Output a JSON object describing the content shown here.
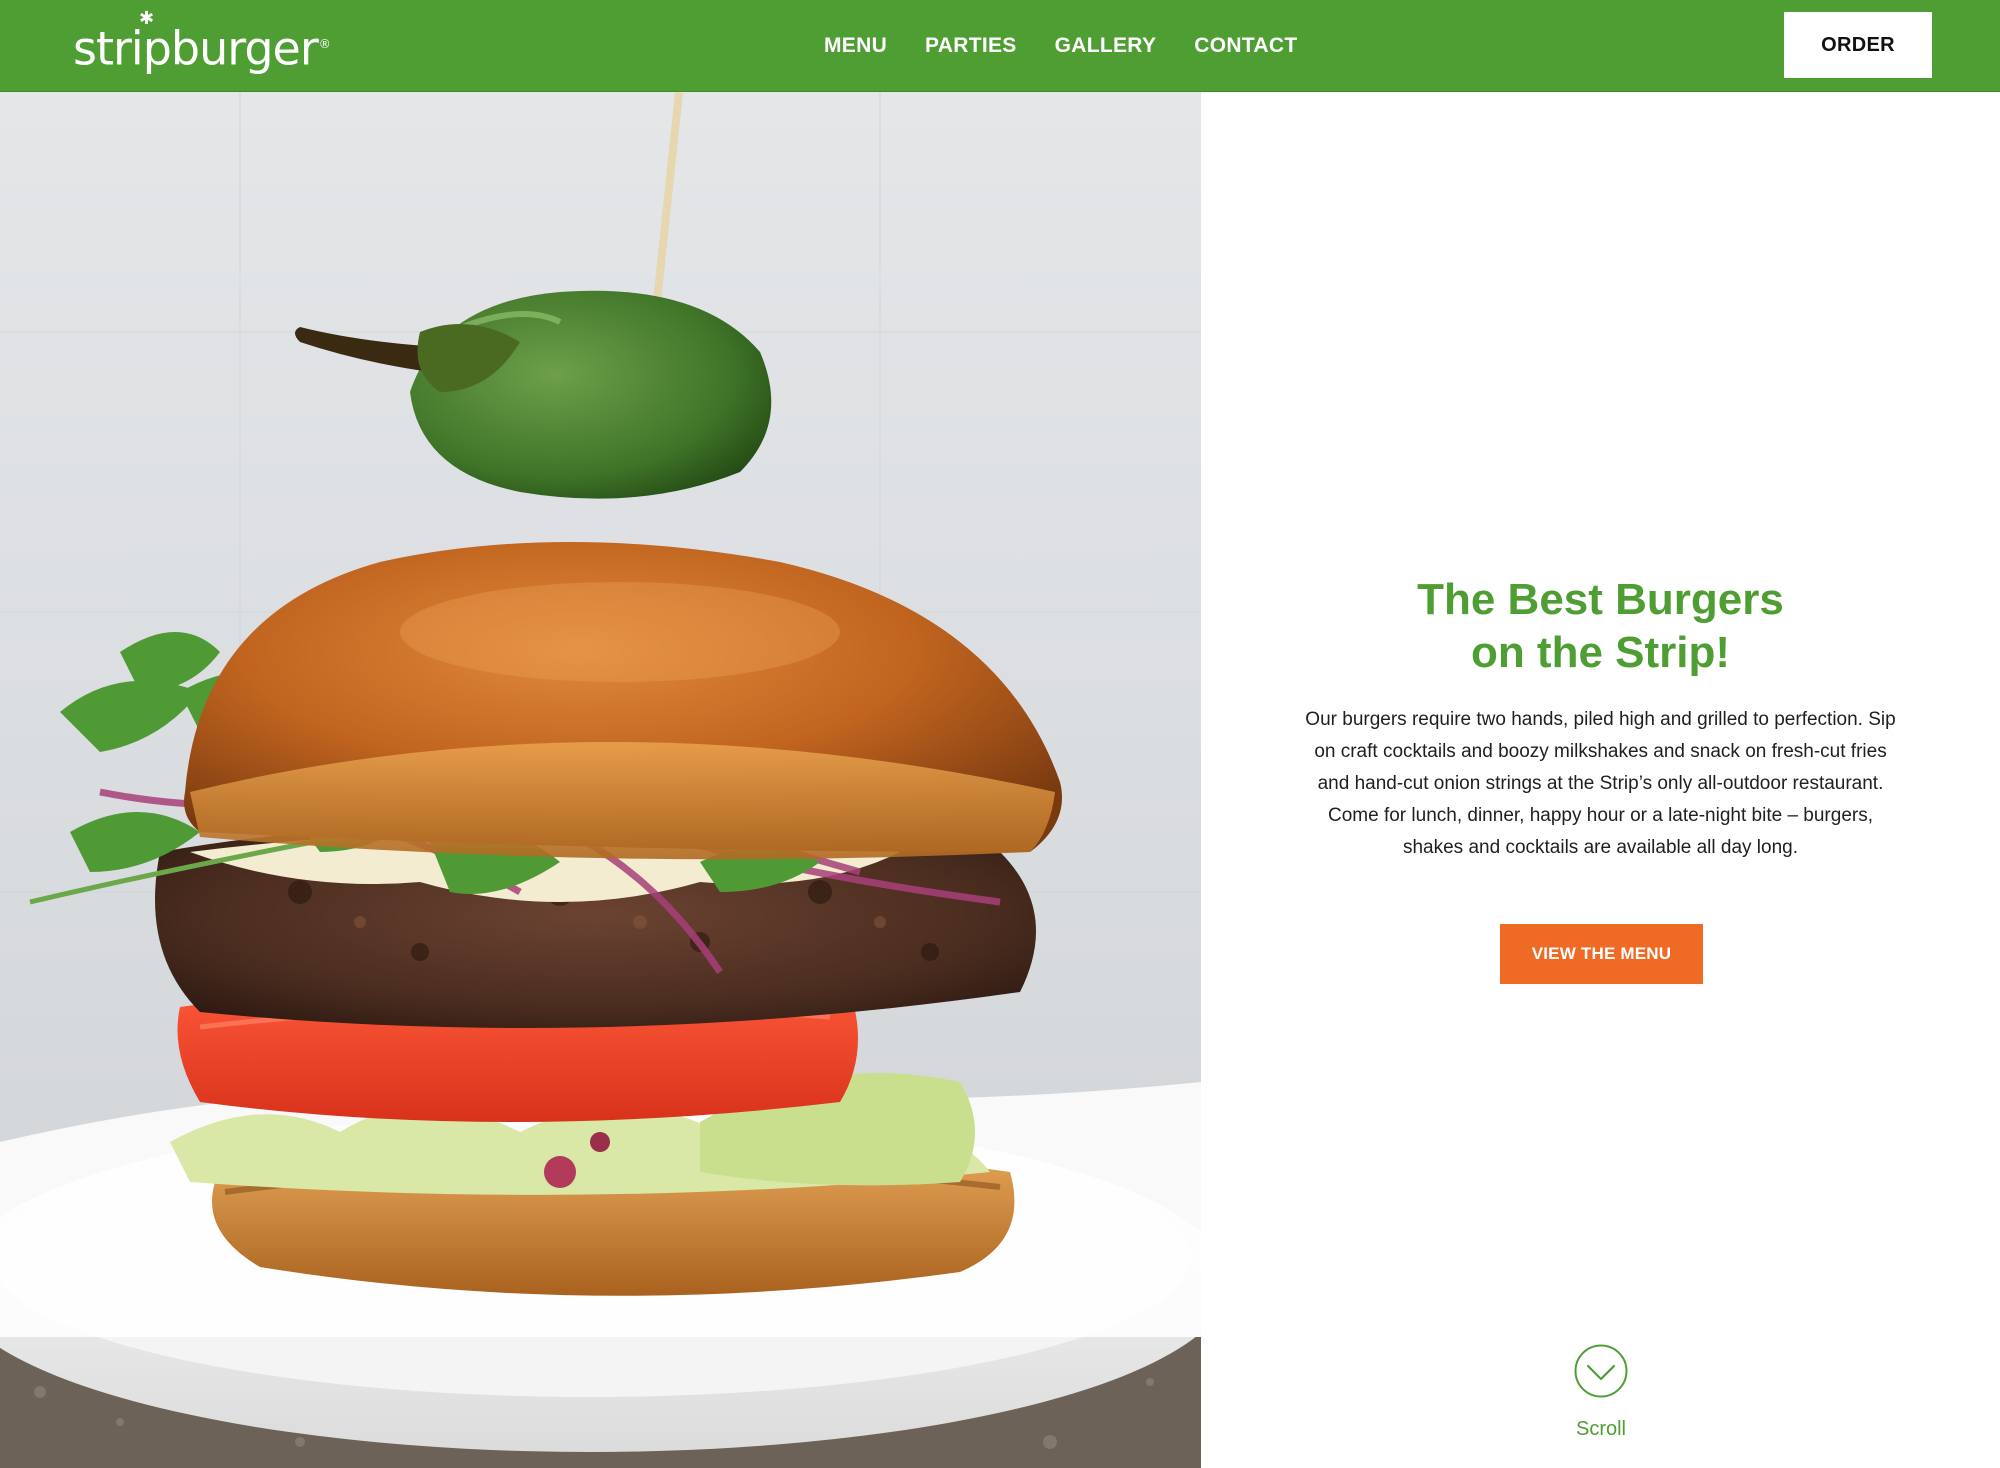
{
  "header": {
    "logo_text": "stripburger",
    "logo_reg": "®",
    "nav": [
      {
        "label": "MENU"
      },
      {
        "label": "PARTIES"
      },
      {
        "label": "GALLERY"
      },
      {
        "label": "CONTACT"
      }
    ],
    "order_label": "ORDER",
    "brand_color": "#4f9e33"
  },
  "hero": {
    "headline_line1": "The Best Burgers",
    "headline_line2": "on the Strip!",
    "description": "Our burgers require two hands, piled high and grilled to perfection. Sip on craft cocktails and boozy milkshakes and snack on fresh-cut fries and hand-cut onion strings at the Strip’s only all-outdoor restaurant. Come for lunch, dinner, happy hour or a late-night bite – burgers, shakes and cocktails are available all day long.",
    "cta_label": "VIEW THE MENU",
    "cta_color": "#ee6a25",
    "scroll_label": "Scroll",
    "scroll_icon": "chevron-down-circle-icon"
  }
}
